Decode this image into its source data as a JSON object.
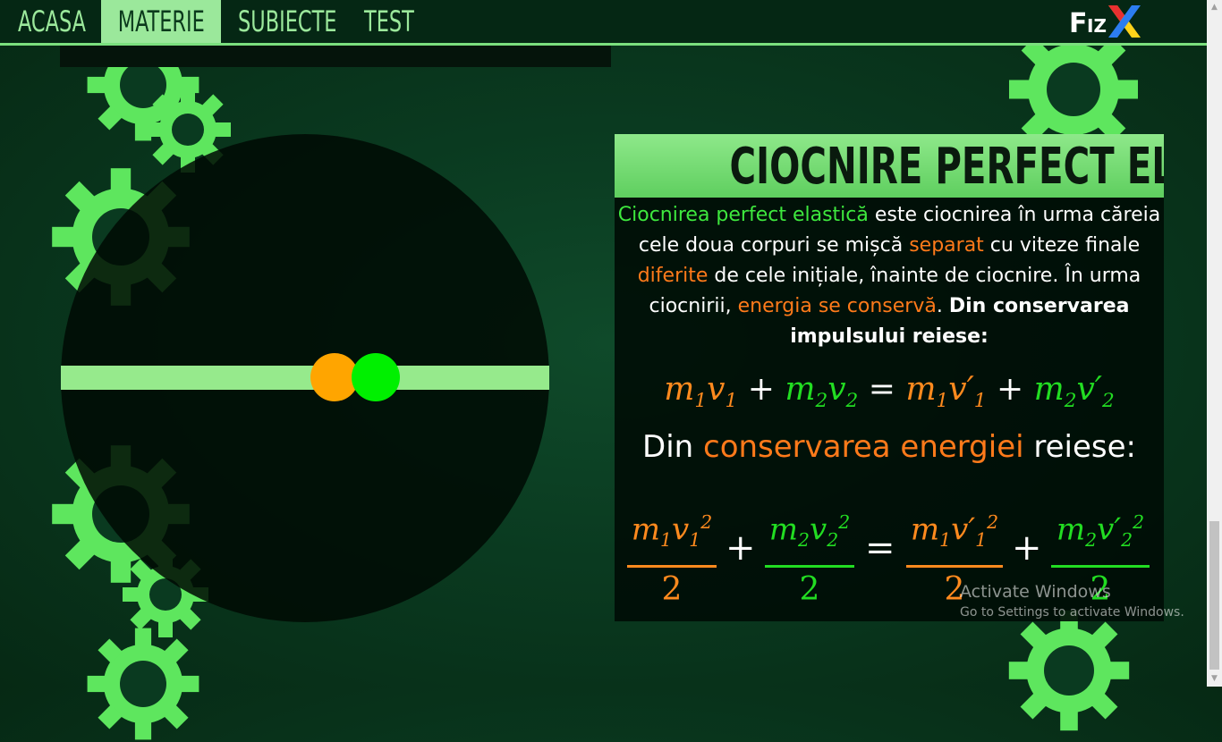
{
  "nav": {
    "items": [
      "ACASA",
      "MATERIE",
      "SUBIECTE",
      "TEST"
    ],
    "active": "MATERIE",
    "logo_text": "FIZX"
  },
  "panel": {
    "title": "CIOCNIRE PERFECT ELASTICĂ",
    "desc": {
      "t1": "Ciocnirea perfect elastică",
      "t2": " este ciocnirea în urma căreia cele doua corpuri se mișcă ",
      "t3": "separat",
      "t4": " cu viteze finale ",
      "t5": "diferite",
      "t6": " de cele inițiale, înainte de ciocnire. În urma ciocnirii, ",
      "t7": "energia se conservă",
      "t8": ". ",
      "t9": "Din conservarea impulsului reiese:"
    },
    "mid": {
      "a": "Din ",
      "b": "conservarea energiei",
      "c": " reiese:"
    }
  },
  "colors": {
    "accent_green": "#9be89b",
    "ball_orange": "#ffa500",
    "ball_green": "#00f000",
    "highlight_orange": "#ff7a1a",
    "highlight_green": "#3ee83e"
  },
  "watermark": {
    "line1": "Activate Windows",
    "line2": "Go to Settings to activate Windows."
  }
}
